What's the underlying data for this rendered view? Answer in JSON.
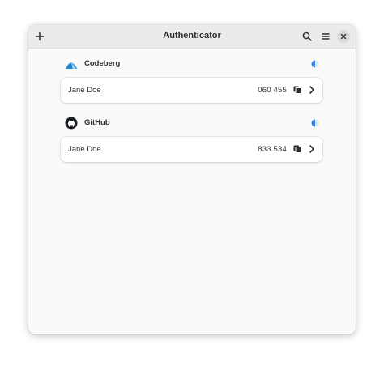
{
  "window": {
    "title": "Authenticator"
  },
  "header": {
    "add_icon": "plus-icon",
    "search_icon": "search-icon",
    "menu_icon": "hamburger-menu-icon",
    "close_icon": "close-icon"
  },
  "providers": [
    {
      "name": "Codeberg",
      "logo_icon": "codeberg-logo-icon",
      "accounts": [
        {
          "name": "Jane Doe",
          "code": "060 455"
        }
      ]
    },
    {
      "name": "GitHub",
      "logo_icon": "github-logo-icon",
      "accounts": [
        {
          "name": "Jane Doe",
          "code": "833 534"
        }
      ]
    }
  ],
  "colors": {
    "accent": "#3584e4",
    "headerbar": "#ebebeb",
    "background": "#fafafa",
    "text": "#2e2e2e"
  }
}
